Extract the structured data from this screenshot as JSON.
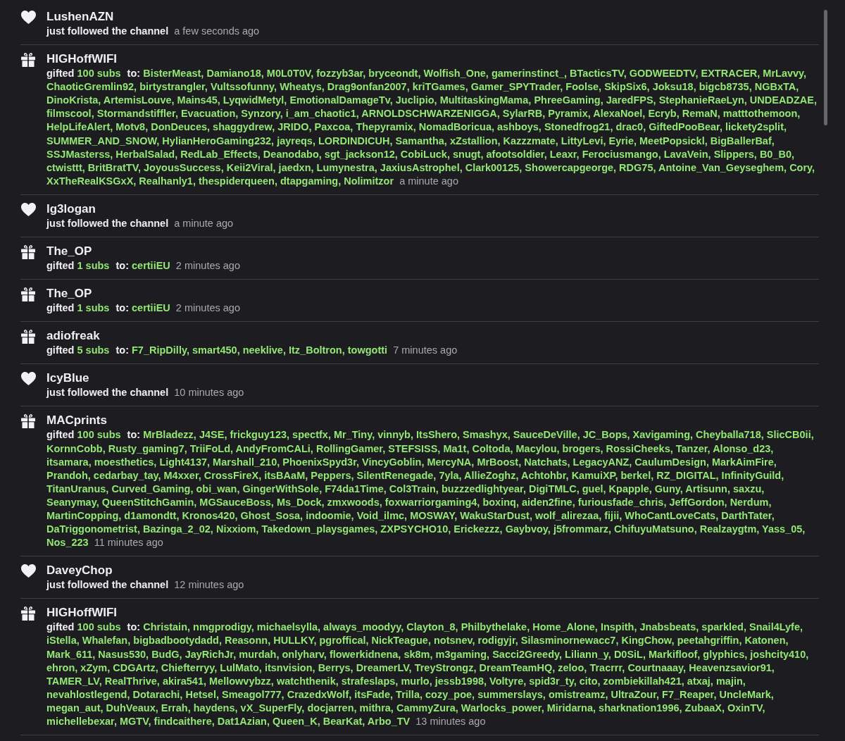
{
  "events": [
    {
      "kind": "follow",
      "user": "LushenAZN",
      "action": "just followed the channel",
      "time": "a few seconds ago"
    },
    {
      "kind": "gift",
      "user": "HIGHoffWIFI",
      "action": "gifted",
      "amount": "100 subs",
      "to_label": "to:",
      "recipients": "BisterMeast, Damiano18, M0L0T0V, fozzyb3ar, bryceondt, Wolfish_One, gamerinstinct_, BTacticsTV, GODWEEDTV, EXTRACER, MrLavvy, ChaoticGremlin92, birtystrangler, Vultssofunny, Wheatys, Drag9onfan2007, kriTGames, Gamer_SPYTrader, Foolse, SkipSix6, Joksu18, bigcb8735, NGBxTA, DinoKrista, ArtemisLouve, Mains45, LyqwidMetyl, EmotionalDamageTv, Juclipio, MultitaskingMama, PhreeGaming, JaredFPS, StephanieRaeLyn, UNDEADZAE, filmscool, Stormandstiffler, Evacuation, Synzory, i_am_chaotic1, ARNOLDSCHWARZENIGGA, SylarRB, Pyramix, AlexaNoel, Ecryb, RemaN, matttothemoon, HelpLifeAlert, Motv8, DonDeuces, shaggydrew, JRIDO, Paxcoa, Thepyramix, NomadBoricua, ashboys, Stonedfrog21, drac0, GiftedPooBear, lickety2split, SUMMER_AND_SNOW, HylianHeroGaming232, jayreqs, LORDINDICUH, Samantha, xZstallion, Kazzzmate, LittyLevi, Eyrie, MeetPopsickl, BigBallerBaf, SSJMasterss, HerbalSalad, RedLab_Effects, Deanodabo, sgt_jackson12, CobiLuck, snugt, afootsoldier, Leaxr, Ferociusmango, LavaVein, Slippers, B0_B0, ctwisttt, BritBratTV, JoyousSuccess, Keii2Viral, jaedxn, Lumynestra, JaxiusAstrophel, Clark00125, Showercapgeorge, RDG75, Antoine_Van_Geyseghem, Cory, XxTheRealKSGxX, Realhanly1, thespiderqueen, dtapgaming, Nolimitzor",
      "time": "a minute ago"
    },
    {
      "kind": "follow",
      "user": "lg3logan",
      "action": "just followed the channel",
      "time": "a minute ago"
    },
    {
      "kind": "gift",
      "user": "The_OP",
      "action": "gifted",
      "amount": "1 subs",
      "to_label": "to:",
      "recipients": "certiiEU",
      "time": "2 minutes ago"
    },
    {
      "kind": "gift",
      "user": "The_OP",
      "action": "gifted",
      "amount": "1 subs",
      "to_label": "to:",
      "recipients": "certiiEU",
      "time": "2 minutes ago"
    },
    {
      "kind": "gift",
      "user": "adiofreak",
      "action": "gifted",
      "amount": "5 subs",
      "to_label": "to:",
      "recipients": "F7_RipDilly, smart450, neeklive, Itz_Boltron, towgotti",
      "time": "7 minutes ago"
    },
    {
      "kind": "follow",
      "user": "IcyBlue",
      "action": "just followed the channel",
      "time": "10 minutes ago"
    },
    {
      "kind": "gift",
      "user": "MACprints",
      "action": "gifted",
      "amount": "100 subs",
      "to_label": "to:",
      "recipients": "MrBladezz, J4SE, frickguy123, spectfx, Mr_Tiny, vinnyb, ItsShero, Smashyx, SauceDeVille, JC_Bops, Xavigaming, Cheyballa718, SlicCB0ii, KornnCobb, Rusty_gaming7, TriiFoLd, AndyFromCALi, RollingGamer, STEFSISS, Ma1t, Coltoda, Macylou, brogers, RossiCheeks, Tanzer, Alonso_d23, itsamara, moesthetics, Light4137, Marshall_210, PhoenixSpyd3r, VincyGoblin, MercyNA, MrBoost, Natchats, LegacyANZ, CaulumDesign, MarkAimFire, Prandoh, cedarbay_tay, M4xxer, CrossFireX, itsBAaM, Peppers, SilentRenegade, 7yla, AllieZoghz, Achtohbr, KamuiXP, berkel, RZ_DIGITAL, InfinityGuild, TitanUranus, Curved_Gaming, obi_wan, GingerWithSole, F74da1Time, Col3Train, buzzzedlightyear, DigiTMLC, guel, Kpapple, Guny, Artisunn, saxzu, Seanymay, QueenStitchGamin, MGSauceBoss, Ms_Dock, zmxwoods, foxwarriorgaming4, boxinq, aiden2fine, furiousfade_chris, JeffGordon, Nerdum, MartinCopping, d1amondtt, Kronos420, Ghost_Sosa, indoomie, Void_ilmc, MOSWAY, WakuStarDust, wolf_alirezaa, fijii, WhoCantLoveCats, DarthTater, DaTriggonometrist, Bazinga_2_02, Nixxiom, Takedown_playsgames, ZXPSYCHO10, Erickezzz, Gaybvoy, j5frommarz, ChifuyuMatsuno, Realzaygtm, Yass_05, Nos_223",
      "time": "11 minutes ago"
    },
    {
      "kind": "follow",
      "user": "DaveyChop",
      "action": "just followed the channel",
      "time": "12 minutes ago"
    },
    {
      "kind": "gift",
      "user": "HIGHoffWIFI",
      "action": "gifted",
      "amount": "100 subs",
      "to_label": "to:",
      "recipients": "Christain, nmgprodigy, michaelsylla, always_moodyy, Clayton_8, Philbythelake, Home_Alone, Inspith, Jnabsbeats, sparkled, Snail4Lyfe, iStella, Whalefan, bigbadbootydadd, Reasonn, HULLKY, pgroffical, NickTeague, notsnev, rodigyjr, Silasminornewacc7, KingChow, peetahgriffin, Katonen, Mark_611, Nasus530, BudG, JayRichJr, murdah, onlyharv, flowerkidnena, sk8m, m3gaming, Sacci2Greedy, Liliann_y, D0SiL, Markifloof, glyphics, joshcity410, ehron, xZym, CDGArtz, Chiefterryy, LulMato, itsnvision, Berrys, DreamerLV, TreyStrongz, DreamTeamHQ, zeloo, Tracrrr, Courtnaaay, Heavenzsavior91, TAMER_LV, RealThrive, akira541, Mellowvybzz, watchthenik, strafeslaps, murlo, jessb1998, Voltyre, spid3r_ty, cito, zombiekillah421, atxaj, majin, nevahlostlegend, Dotarachi, Hetsel, Smeagol777, CrazedxWolf, itsFade, Trilla, cozy_poe, summerslays, omistreamz, UltraZour, F7_Reaper, UncleMark, megan_aut, DuhVeaux, Errah, haydens, vX_SuperFly, docjarren, mithra, CammyZura, Warlocks_power, Miridarna, sharknation1996, ZubaaX, OxinTV, michellebexar, MGTV, findcaithere, Dat1Azian, Queen_K, BearKat, Arbo_TV",
      "time": "13 minutes ago"
    }
  ]
}
